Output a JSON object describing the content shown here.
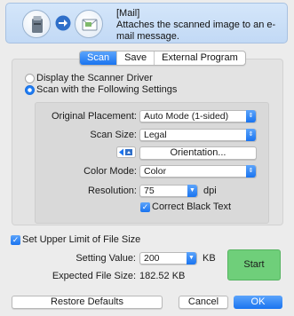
{
  "banner": {
    "title": "[Mail]",
    "description": "Attaches the scanned image to an e-mail message."
  },
  "tabs": [
    {
      "label": "Scan",
      "active": true
    },
    {
      "label": "Save",
      "active": false
    },
    {
      "label": "External Program",
      "active": false
    }
  ],
  "mode": {
    "option_driver": "Display the Scanner Driver",
    "option_settings": "Scan with the Following Settings",
    "selected": "settings"
  },
  "settings": {
    "original_placement": {
      "label": "Original Placement:",
      "value": "Auto Mode (1-sided)"
    },
    "scan_size": {
      "label": "Scan Size:",
      "value": "Legal"
    },
    "orientation_button": "Orientation...",
    "color_mode": {
      "label": "Color Mode:",
      "value": "Color"
    },
    "resolution": {
      "label": "Resolution:",
      "value": "75",
      "unit": "dpi"
    },
    "correct_black_text": {
      "label": "Correct Black Text",
      "checked": true
    }
  },
  "file_size": {
    "limit_label": "Set Upper Limit of File Size",
    "limit_checked": true,
    "setting_label": "Setting Value:",
    "setting_value": "200",
    "setting_unit": "KB",
    "expected_label": "Expected File Size:",
    "expected_value": "182.52 KB"
  },
  "buttons": {
    "start": "Start",
    "restore_defaults": "Restore Defaults",
    "cancel": "Cancel",
    "ok": "OK"
  },
  "colors": {
    "accent": "#1a74f0",
    "start_green": "#6fcf7a"
  }
}
